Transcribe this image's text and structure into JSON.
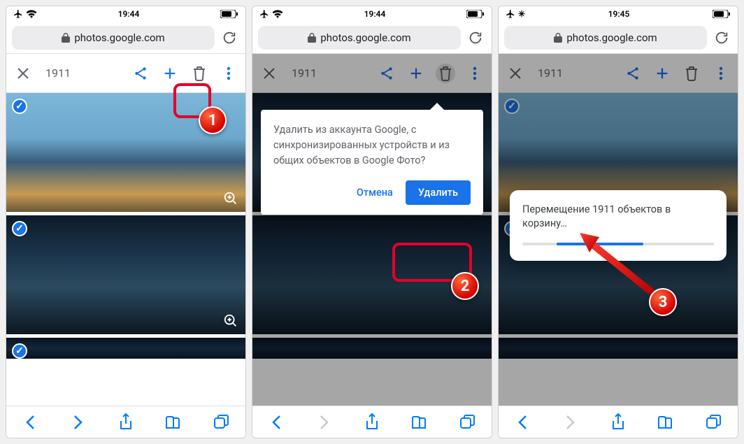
{
  "screens": [
    {
      "status": {
        "time": "19:44"
      },
      "url": "photos.google.com",
      "selection_count": "1911",
      "step_label": "1"
    },
    {
      "status": {
        "time": "19:44"
      },
      "url": "photos.google.com",
      "selection_count": "1911",
      "popover": {
        "text": "Удалить из аккаунта Google, с синхронизированных устройств и из общих объектов в Google Фото?",
        "cancel": "Отмена",
        "confirm": "Удалить"
      },
      "step_label": "2"
    },
    {
      "status": {
        "time": "19:45"
      },
      "url": "photos.google.com",
      "selection_count": "1911",
      "progress": {
        "text": "Перемещение 1911 объектов в корзину…"
      },
      "step_label": "3"
    }
  ]
}
